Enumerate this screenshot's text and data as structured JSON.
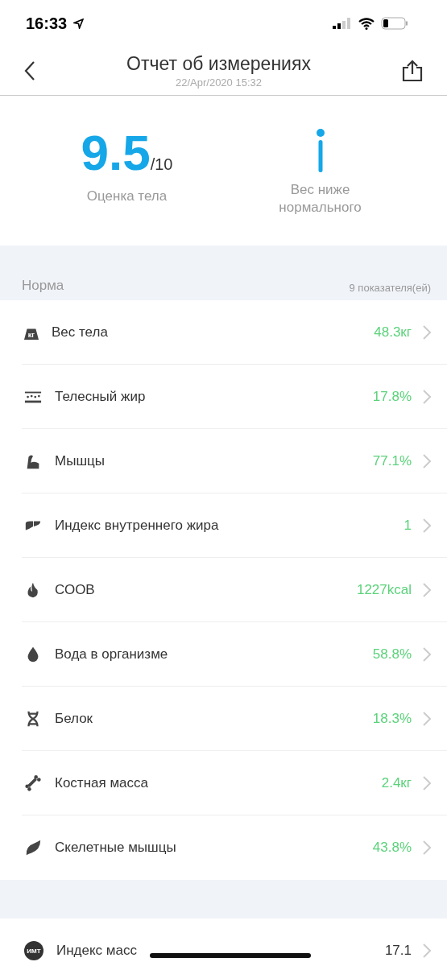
{
  "status_bar": {
    "time": "16:33"
  },
  "header": {
    "title": "Отчет об измерениях",
    "subtitle": "22/Apr/2020 15:32"
  },
  "summary": {
    "score": "9.5",
    "score_max": "/10",
    "score_label": "Оценка тела",
    "body_type": "Вес ниже нормального"
  },
  "section": {
    "title": "Норма",
    "count": "9 показателя(ей)"
  },
  "metrics": [
    {
      "kind": "weight",
      "badge": "кг",
      "label": "Вес тела",
      "value": "48.3кг",
      "color": "#5bd27a"
    },
    {
      "kind": "fat",
      "label": "Телесный жир",
      "value": "17.8%",
      "color": "#5bd27a"
    },
    {
      "kind": "muscle",
      "label": "Мышцы",
      "value": "77.1%",
      "color": "#5bd27a"
    },
    {
      "kind": "visceral",
      "label": "Индекс внутреннего жира",
      "value": "1",
      "color": "#5bd27a"
    },
    {
      "kind": "flame",
      "label": "СООВ",
      "value": "1227kcal",
      "color": "#5bd27a"
    },
    {
      "kind": "drop",
      "label": "Вода в организме",
      "value": "58.8%",
      "color": "#5bd27a"
    },
    {
      "kind": "dna",
      "label": "Белок",
      "value": "18.3%",
      "color": "#5bd27a"
    },
    {
      "kind": "bone",
      "label": "Костная масса",
      "value": "2.4кг",
      "color": "#5bd27a"
    },
    {
      "kind": "leaf",
      "label": "Скелетные мышцы",
      "value": "43.8%",
      "color": "#5bd27a"
    }
  ],
  "other_metrics": [
    {
      "kind": "bmi",
      "badge": "ИМТ",
      "label": "Индекс масс",
      "value": "17.1",
      "color": "#333333"
    }
  ]
}
